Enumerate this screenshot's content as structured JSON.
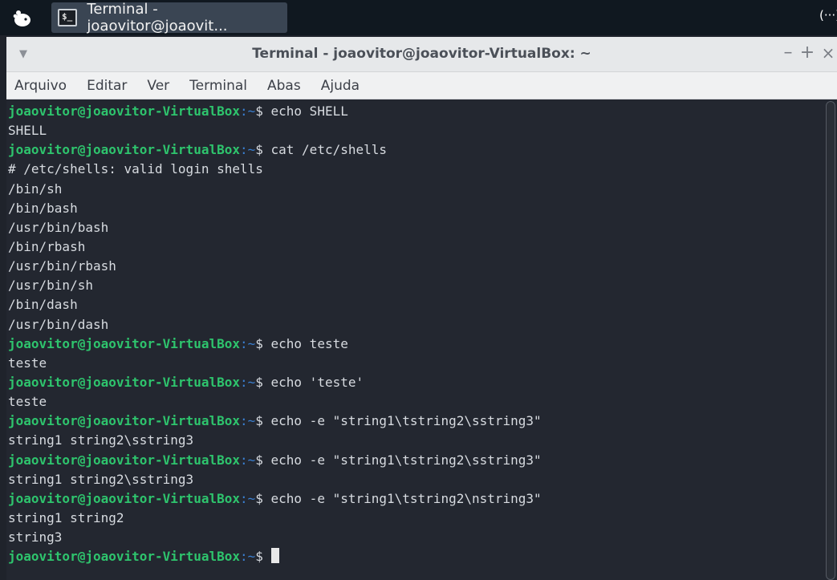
{
  "taskbar": {
    "task_title": "Terminal - joaovitor@joaovit...",
    "tray_text": "(···)"
  },
  "window": {
    "title": "Terminal - joaovitor@joaovitor-VirtualBox: ~",
    "controls": {
      "minimize": "–",
      "maximize": "+",
      "close": "×"
    }
  },
  "menu": [
    "Arquivo",
    "Editar",
    "Ver",
    "Terminal",
    "Abas",
    "Ajuda"
  ],
  "terminal": {
    "prompt_user": "joaovitor@joaovitor-VirtualBox",
    "prompt_path": ":~",
    "prompt_symbol": "$ ",
    "lines": [
      {
        "cmd": "echo SHELL"
      },
      {
        "out": "SHELL"
      },
      {
        "cmd": "cat /etc/shells"
      },
      {
        "out": "# /etc/shells: valid login shells"
      },
      {
        "out": "/bin/sh"
      },
      {
        "out": "/bin/bash"
      },
      {
        "out": "/usr/bin/bash"
      },
      {
        "out": "/bin/rbash"
      },
      {
        "out": "/usr/bin/rbash"
      },
      {
        "out": "/usr/bin/sh"
      },
      {
        "out": "/bin/dash"
      },
      {
        "out": "/usr/bin/dash"
      },
      {
        "cmd": "echo teste"
      },
      {
        "out": "teste"
      },
      {
        "cmd": "echo 'teste'"
      },
      {
        "out": "teste"
      },
      {
        "cmd": "echo -e \"string1\\tstring2\\sstring3\""
      },
      {
        "out": "string1 string2\\sstring3"
      },
      {
        "cmd": "echo -e \"string1\\tstring2\\sstring3\""
      },
      {
        "out": "string1 string2\\sstring3"
      },
      {
        "cmd": "echo -e \"string1\\tstring2\\nstring3\""
      },
      {
        "out": "string1 string2"
      },
      {
        "out": "string3"
      },
      {
        "cmd": "",
        "cursor": true
      }
    ]
  },
  "colors": {
    "prompt_user": "#2ec46d",
    "prompt_path": "#3a7fd1",
    "terminal_bg": "#232730",
    "terminal_fg": "#d7dbe0"
  }
}
